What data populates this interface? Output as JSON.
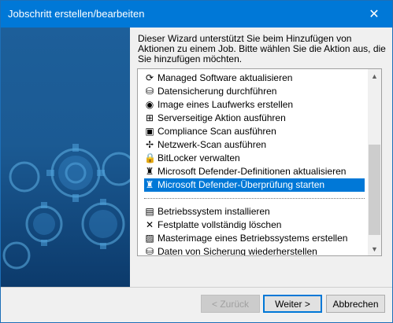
{
  "window": {
    "title": "Jobschritt erstellen/bearbeiten",
    "close_glyph": "✕"
  },
  "intro_text": "Dieser Wizard unterstützt Sie beim Hinzufügen von Aktionen zu einem Job. Bitte wählen Sie die Aktion aus, die Sie hinzufügen möchten.",
  "list": {
    "items": [
      {
        "label": "Managed Software aktualisieren",
        "icon": "refresh-icon",
        "glyph": "⟳"
      },
      {
        "label": "Datensicherung durchführen",
        "icon": "backup-icon",
        "glyph": "⛁"
      },
      {
        "label": "Image eines Laufwerks erstellen",
        "icon": "disk-image-icon",
        "glyph": "◉"
      },
      {
        "label": "Serverseitige Aktion ausführen",
        "icon": "server-tree-icon",
        "glyph": "⊞"
      },
      {
        "label": "Compliance Scan ausführen",
        "icon": "compliance-icon",
        "glyph": "▣"
      },
      {
        "label": "Netzwerk-Scan ausführen",
        "icon": "network-icon",
        "glyph": "✢"
      },
      {
        "label": "BitLocker verwalten",
        "icon": "lock-icon",
        "glyph": "🔒"
      },
      {
        "label": "Microsoft Defender-Definitionen aktualisieren",
        "icon": "defender-tower-icon",
        "glyph": "♜"
      },
      {
        "label": "Microsoft Defender-Überprüfung starten",
        "icon": "defender-tower-icon",
        "glyph": "♜",
        "selected": true
      },
      {
        "separator": true
      },
      {
        "label": "Betriebssystem installieren",
        "icon": "os-install-icon",
        "glyph": "▤"
      },
      {
        "label": "Festplatte vollständig löschen",
        "icon": "erase-icon",
        "glyph": "✕"
      },
      {
        "label": "Masterimage eines Betriebssystems erstellen",
        "icon": "master-image-icon",
        "glyph": "▨"
      },
      {
        "label": "Daten von Sicherung wiederherstellen",
        "icon": "restore-icon",
        "glyph": "⛁"
      }
    ]
  },
  "buttons": {
    "back": "< Zurück",
    "next": "Weiter >",
    "cancel": "Abbrechen"
  },
  "colors": {
    "accent": "#0078d7",
    "banner": "#1b5a93"
  }
}
